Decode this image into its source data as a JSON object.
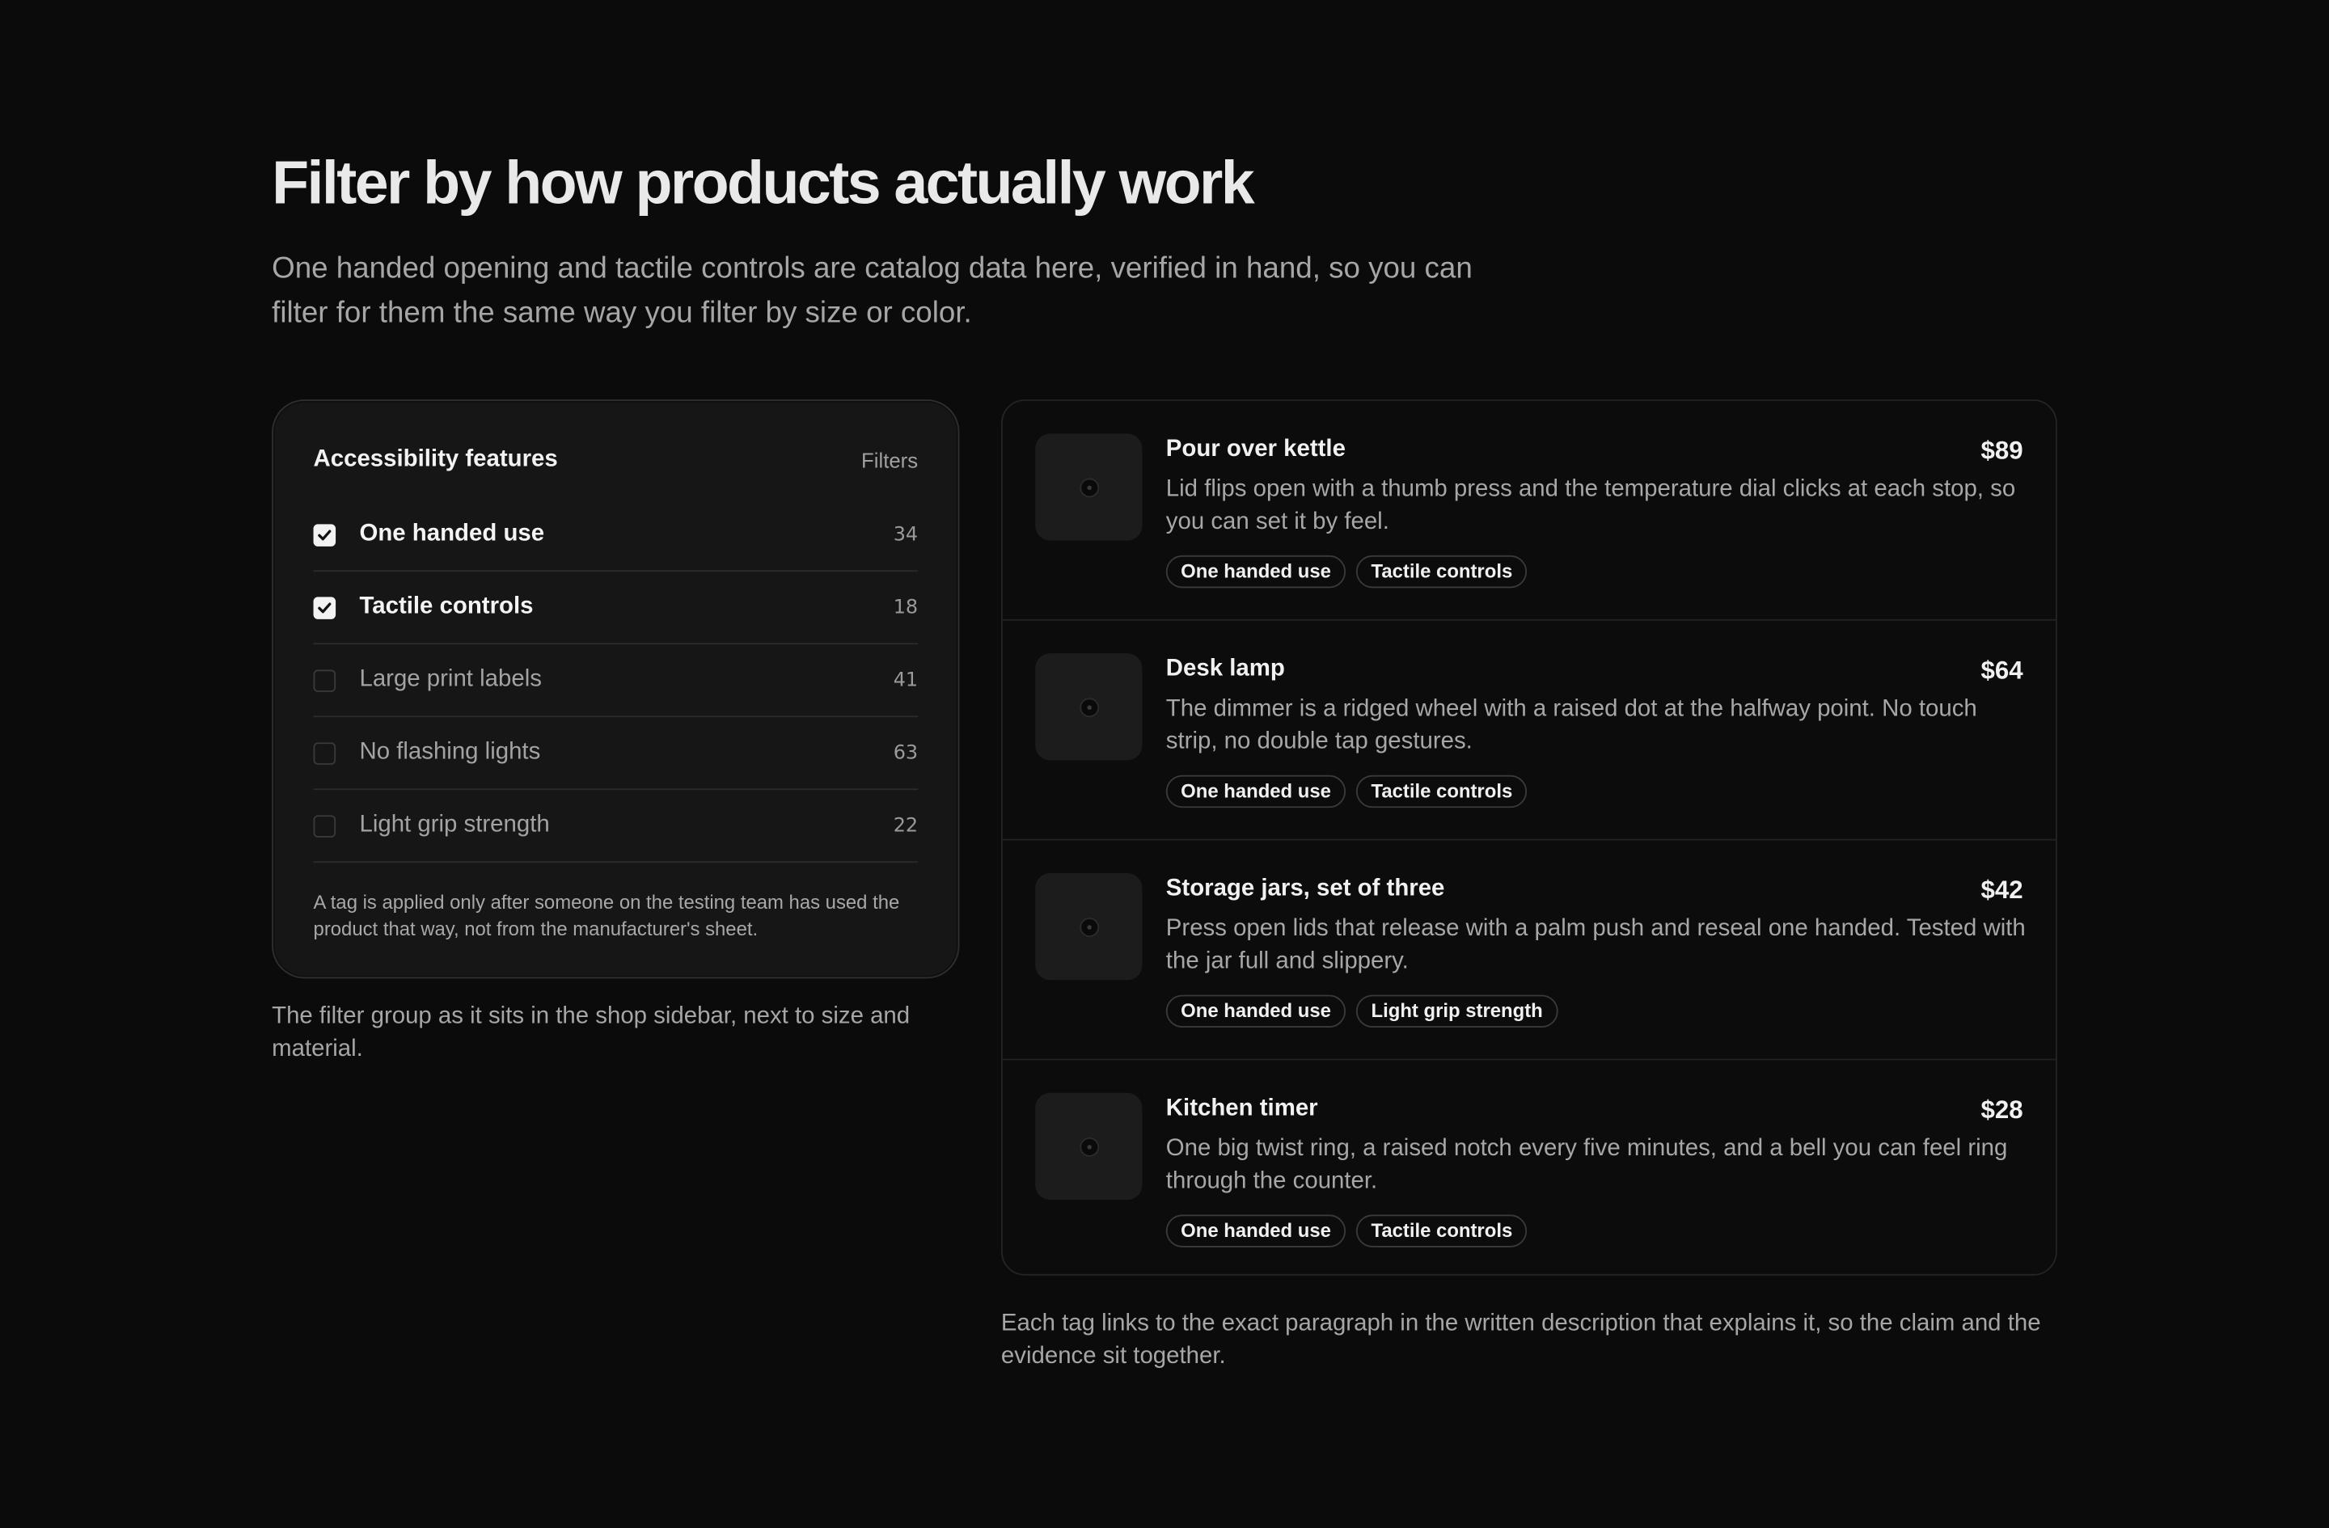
{
  "heading": {
    "title": "Filter by how products actually work",
    "subtitle": "One handed opening and tactile controls are catalog data here, verified in hand, so you can filter for them the same way you filter by size or color."
  },
  "filter_panel": {
    "title": "Accessibility features",
    "filters_label": "Filters",
    "options": [
      {
        "label": "One handed use",
        "count": "34",
        "checked": true
      },
      {
        "label": "Tactile controls",
        "count": "18",
        "checked": true
      },
      {
        "label": "Large print labels",
        "count": "41",
        "checked": false
      },
      {
        "label": "No flashing lights",
        "count": "63",
        "checked": false
      },
      {
        "label": "Light grip strength",
        "count": "22",
        "checked": false
      }
    ],
    "note": "A tag is applied only after someone on the testing team has used the product that way, not from the manufacturer's sheet.",
    "caption": "The filter group as it sits in the shop sidebar, next to size and material."
  },
  "products": {
    "items": [
      {
        "name": "Pour over kettle",
        "price": "$89",
        "description": "Lid flips open with a thumb press and the temperature dial clicks at each stop, so you can set it by feel.",
        "tags": [
          "One handed use",
          "Tactile controls"
        ]
      },
      {
        "name": "Desk lamp",
        "price": "$64",
        "description": "The dimmer is a ridged wheel with a raised dot at the halfway point. No touch strip, no double tap gestures.",
        "tags": [
          "One handed use",
          "Tactile controls"
        ]
      },
      {
        "name": "Storage jars, set of three",
        "price": "$42",
        "description": "Press open lids that release with a palm push and reseal one handed. Tested with the jar full and slippery.",
        "tags": [
          "One handed use",
          "Light grip strength"
        ]
      },
      {
        "name": "Kitchen timer",
        "price": "$28",
        "description": "One big twist ring, a raised notch every five minutes, and a bell you can feel ring through the counter.",
        "tags": [
          "One handed use",
          "Tactile controls"
        ]
      }
    ],
    "caption": "Each tag links to the exact paragraph in the written description that explains it, so the claim and the evidence sit together."
  },
  "icons": {
    "checkbox_checked": "check-icon",
    "product_placeholder": "image-placeholder-icon"
  },
  "colors": {
    "background": "#0b0b0b",
    "panel": "#161616",
    "text": "#ededed",
    "muted": "#a6a6a6"
  }
}
